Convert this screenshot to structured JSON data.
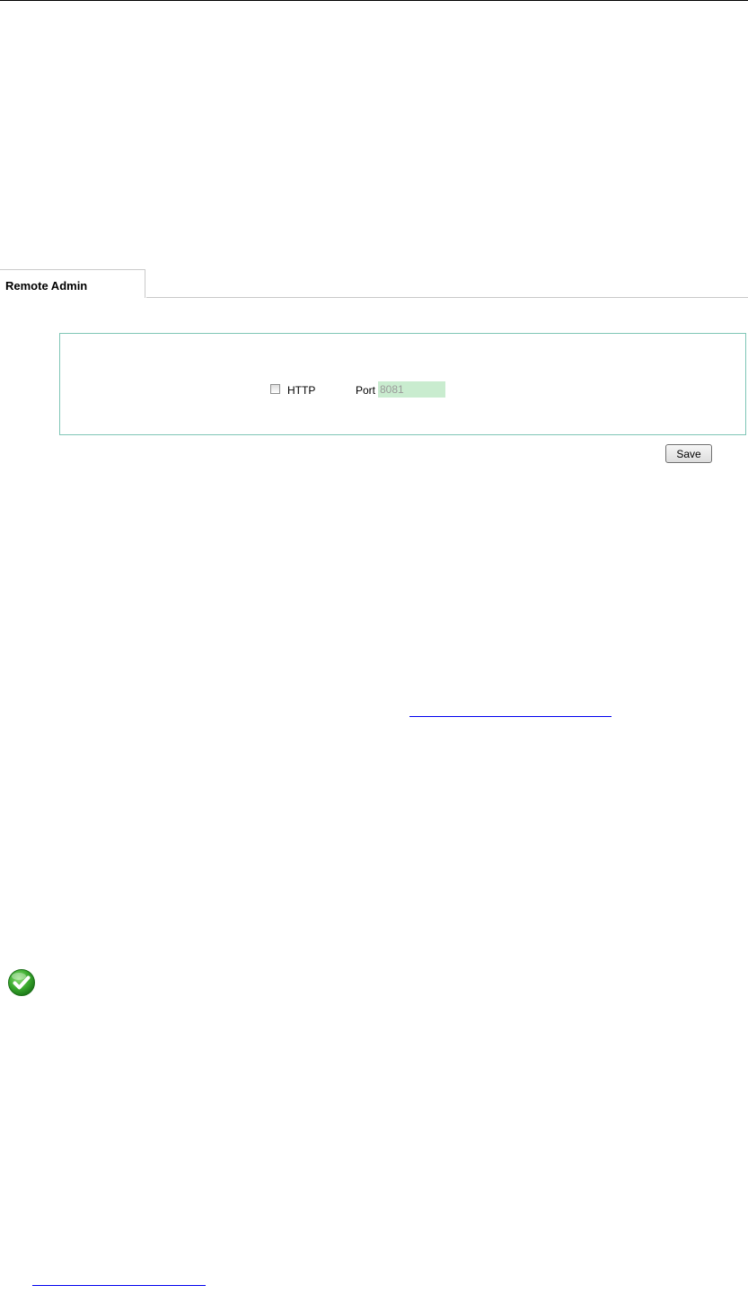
{
  "tabs": [
    {
      "label": "Remote Admin"
    }
  ],
  "remote_admin": {
    "http_label": "HTTP",
    "http_checked": false,
    "port_label": "Port",
    "port_value": "8081"
  },
  "actions": {
    "save_label": "Save"
  },
  "icons": {
    "status": "check-circle-icon"
  },
  "colors": {
    "panel_border": "#7fc6b6",
    "port_field_bg": "#c9eccf",
    "link": "#0000ee",
    "success": "#2fa52f"
  }
}
